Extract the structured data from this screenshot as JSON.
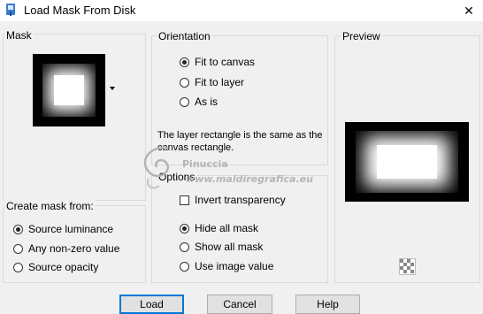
{
  "window": {
    "title": "Load Mask From Disk",
    "close_icon": "close-icon"
  },
  "mask_group": {
    "label": "Mask"
  },
  "orientation": {
    "label": "Orientation",
    "options": [
      "Fit to canvas",
      "Fit to layer",
      "As is"
    ],
    "selected": 0,
    "description": "The layer rectangle is the same as the canvas rectangle."
  },
  "preview": {
    "label": "Preview"
  },
  "create_mask": {
    "label": "Create mask from:",
    "options": [
      "Source luminance",
      "Any non-zero value",
      "Source opacity"
    ],
    "selected": 0
  },
  "options": {
    "label": "Options",
    "invert_label": "Invert transparency",
    "invert_checked": false,
    "show_options": [
      "Hide all mask",
      "Show all mask",
      "Use image value"
    ],
    "selected": 0
  },
  "buttons": {
    "load": "Load",
    "cancel": "Cancel",
    "help": "Help"
  },
  "watermark": {
    "name": "Pinuccia",
    "site": "www.maldiregrafica.eu"
  }
}
